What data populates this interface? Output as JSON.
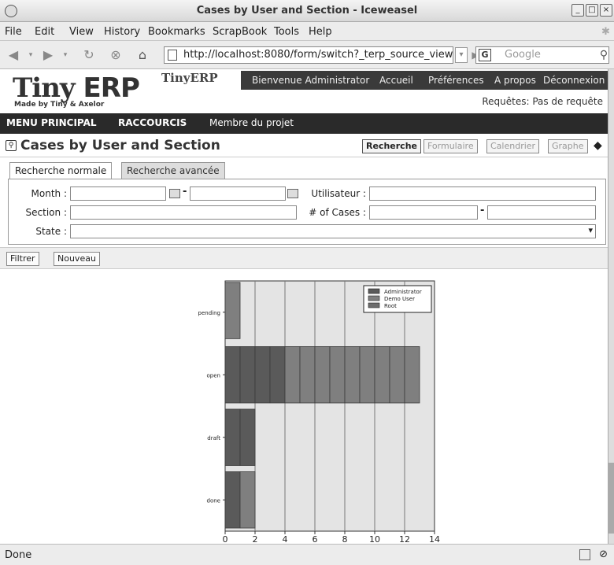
{
  "window": {
    "title": "Cases by User and Section - Iceweasel"
  },
  "menubar": {
    "items": [
      "File",
      "Edit",
      "View",
      "History",
      "Bookmarks",
      "ScrapBook",
      "Tools",
      "Help"
    ]
  },
  "navbar": {
    "url": "http://localhost:8080/form/switch?_terp_source_view",
    "search_placeholder": "Google"
  },
  "header": {
    "logo": "TinyERP",
    "logo_sub": "Made by Tiny & Axelor",
    "welcome": "Bienvenue Administrator",
    "links": [
      "Accueil",
      "Préférences",
      "A propos",
      "Déconnexion"
    ],
    "requests": "Requêtes: Pas de requête"
  },
  "mainmenu": {
    "items": [
      "MENU PRINCIPAL",
      "RACCOURCIS",
      "Membre du projet"
    ]
  },
  "page": {
    "title": "Cases by User and Section",
    "views": [
      "Recherche",
      "Formulaire",
      "Calendrier",
      "Graphe"
    ]
  },
  "search": {
    "tabs": [
      "Recherche normale",
      "Recherche avancée"
    ],
    "labels": {
      "month": "Month :",
      "section": "Section :",
      "state": "State :",
      "user": "Utilisateur :",
      "cases": "# of Cases :"
    }
  },
  "toolbar": {
    "filter": "Filtrer",
    "new": "Nouveau"
  },
  "status": {
    "text": "Done"
  },
  "chart_data": {
    "type": "bar",
    "orientation": "horizontal",
    "stacked": true,
    "categories": [
      "pending",
      "open",
      "draft",
      "done"
    ],
    "series": [
      {
        "name": "Administrator",
        "values": [
          0,
          4,
          2,
          1
        ],
        "color": "#5a5a5a"
      },
      {
        "name": "Demo User",
        "values": [
          1,
          9,
          0,
          1
        ],
        "color": "#7f7f7f"
      },
      {
        "name": "Root",
        "values": [
          0,
          0,
          0,
          0
        ],
        "color": "#6c6c6c"
      }
    ],
    "xlim": [
      0,
      14
    ],
    "xticks": [
      0,
      2,
      4,
      6,
      8,
      10,
      12,
      14
    ],
    "grid": true,
    "legend": "top-right"
  }
}
